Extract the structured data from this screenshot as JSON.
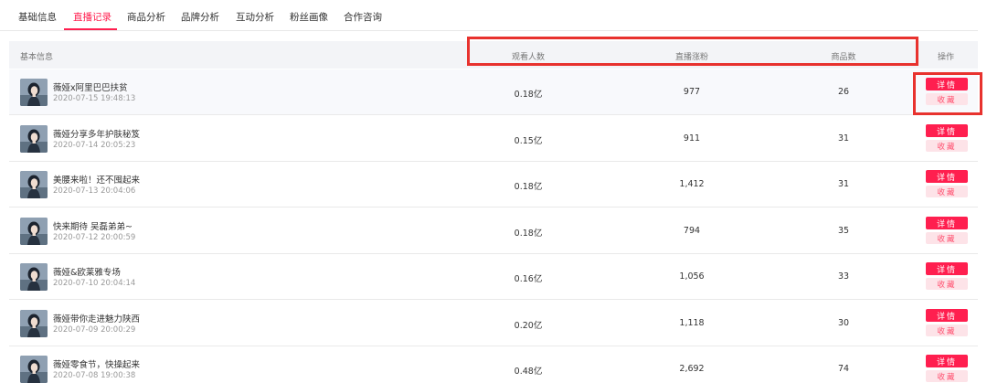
{
  "tabs": [
    {
      "label": "基础信息",
      "active": false
    },
    {
      "label": "直播记录",
      "active": true
    },
    {
      "label": "商品分析",
      "active": false
    },
    {
      "label": "品牌分析",
      "active": false
    },
    {
      "label": "互动分析",
      "active": false
    },
    {
      "label": "粉丝画像",
      "active": false
    },
    {
      "label": "合作咨询",
      "active": false
    }
  ],
  "table": {
    "headers": {
      "basic": "基本信息",
      "viewers": "观看人数",
      "new_fans": "直播涨粉",
      "products": "商品数",
      "actions": "操作"
    },
    "detail_label": "详情",
    "fav_label": "收藏",
    "rows": [
      {
        "title": "薇娅x阿里巴巴扶贫",
        "time": "2020-07-15 19:48:13",
        "viewers": "0.18亿",
        "new_fans": "977",
        "products": "26"
      },
      {
        "title": "薇娅分享多年护肤秘笈",
        "time": "2020-07-14 20:05:23",
        "viewers": "0.15亿",
        "new_fans": "911",
        "products": "31"
      },
      {
        "title": "美腰来啦！还不囤起来",
        "time": "2020-07-13 20:04:06",
        "viewers": "0.18亿",
        "new_fans": "1,412",
        "products": "31"
      },
      {
        "title": "快来期待 吴磊弟弟~",
        "time": "2020-07-12 20:00:59",
        "viewers": "0.18亿",
        "new_fans": "794",
        "products": "35"
      },
      {
        "title": "薇娅&欧莱雅专场",
        "time": "2020-07-10 20:04:14",
        "viewers": "0.16亿",
        "new_fans": "1,056",
        "products": "33"
      },
      {
        "title": "薇娅带你走进魅力陕西",
        "time": "2020-07-09 20:00:29",
        "viewers": "0.20亿",
        "new_fans": "1,118",
        "products": "30"
      },
      {
        "title": "薇娅零食节，快操起来",
        "time": "2020-07-08 19:00:38",
        "viewers": "0.48亿",
        "new_fans": "2,692",
        "products": "74"
      }
    ]
  },
  "colors": {
    "accent": "#ff1f4f",
    "highlight_box": "#e8322e",
    "header_bg": "#f3f4f7"
  }
}
